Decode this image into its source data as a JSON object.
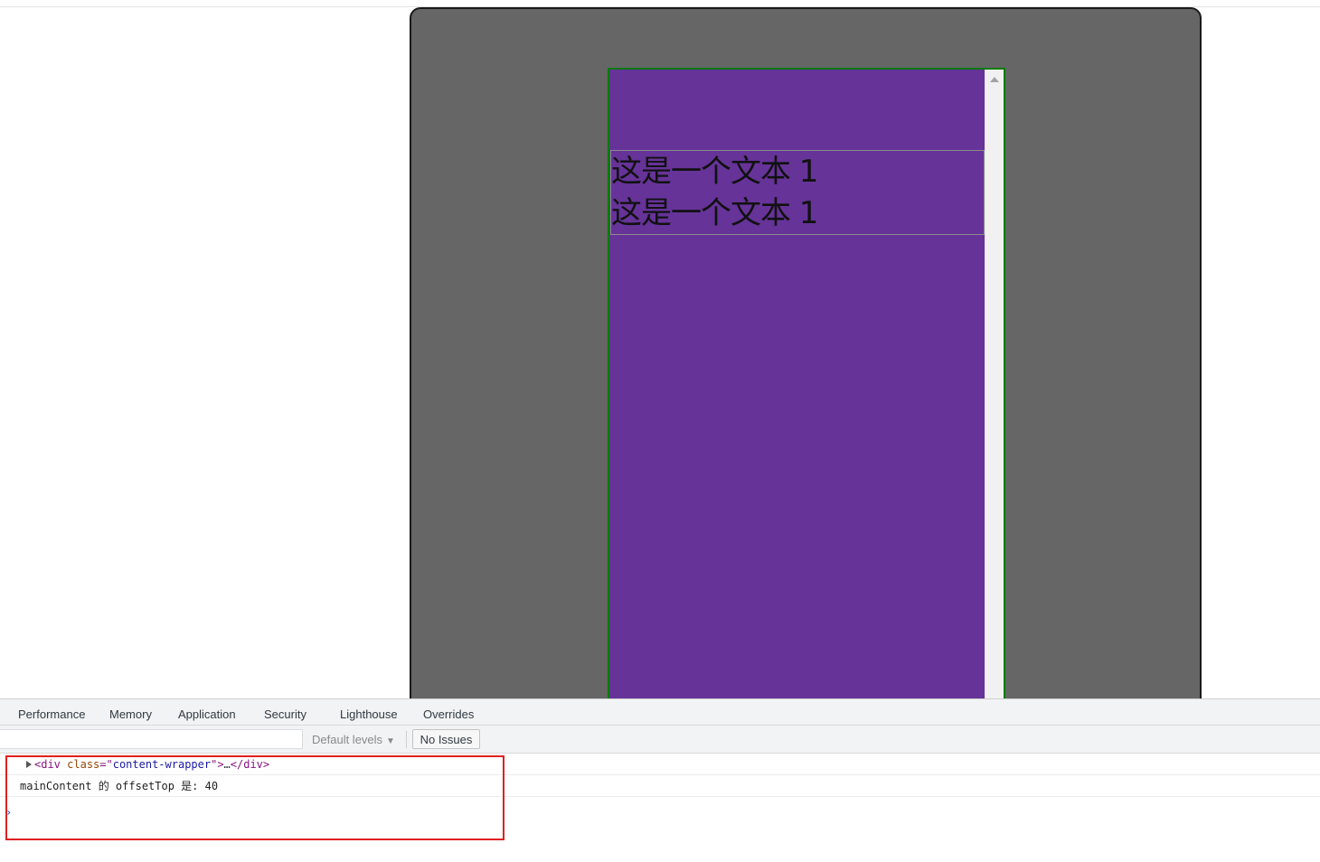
{
  "page": {
    "text_lines": [
      "这是一个文本 1",
      "这是一个文本 1"
    ]
  },
  "devtools": {
    "tabs": [
      "Performance",
      "Memory",
      "Application",
      "Security",
      "Lighthouse",
      "Overrides"
    ],
    "filter_placeholder": "",
    "levels_label": "Default levels",
    "issues_label": "No Issues"
  },
  "console": {
    "element_entry": {
      "tag_open": "<div",
      "attr_name": "class",
      "attr_eq": "=\"",
      "attr_value": "content-wrapper",
      "attr_close": "\">",
      "ellipsis": "…",
      "tag_close": "</div>"
    },
    "log_message": "mainContent 的 offsetTop 是: 40",
    "prompt": "›"
  },
  "colors": {
    "outer_box": "#666666",
    "scroll_box": "#663399",
    "scroll_border": "#0b7a0b",
    "highlight": "#e02020"
  }
}
